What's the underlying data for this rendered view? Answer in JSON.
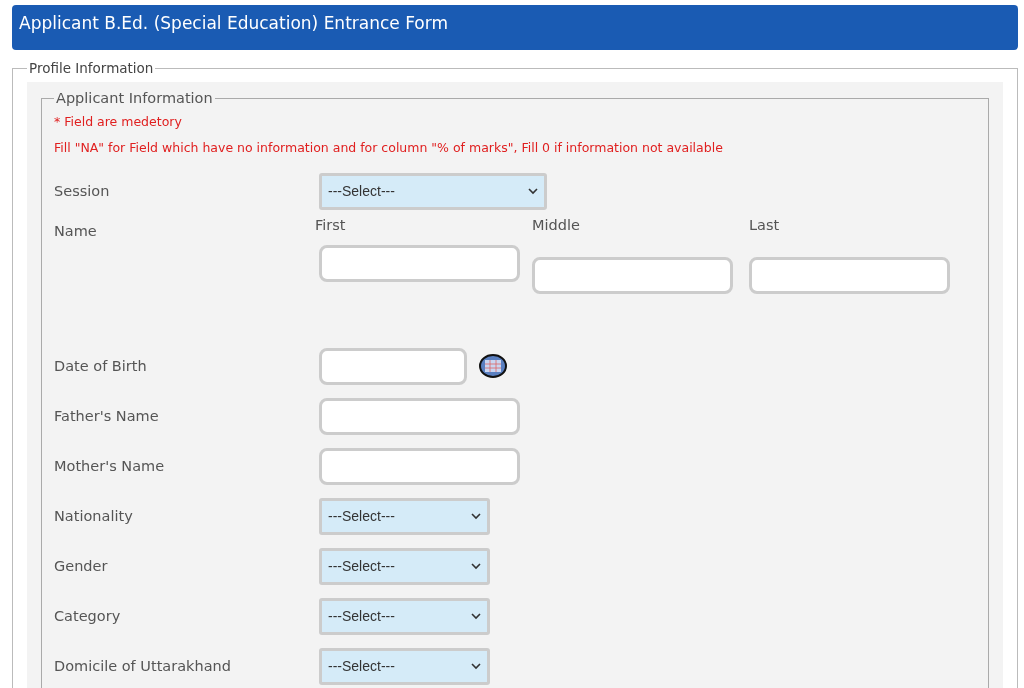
{
  "header": {
    "title": "Applicant B.Ed. (Special Education) Entrance Form"
  },
  "profile": {
    "legend": "Profile Information",
    "applicant": {
      "legend": "Applicant Information",
      "notes": [
        "* Field are medetory",
        "Fill \"NA\" for Field which have no information and for column \"% of marks\", Fill 0 if information not available"
      ],
      "fields": [
        {
          "kind": "select",
          "label": "Session",
          "value": "---Select---"
        },
        {
          "kind": "name",
          "label": "Name",
          "parts": [
            {
              "label": "First"
            },
            {
              "label": "Middle"
            },
            {
              "label": "Last"
            }
          ]
        },
        {
          "kind": "date",
          "label": "Date of Birth"
        },
        {
          "kind": "text",
          "label": "Father's Name"
        },
        {
          "kind": "text",
          "label": "Mother's Name"
        },
        {
          "kind": "select",
          "label": "Nationality",
          "value": "---Select---"
        },
        {
          "kind": "select",
          "label": "Gender",
          "value": "---Select---"
        },
        {
          "kind": "select",
          "label": "Category",
          "value": "---Select---"
        },
        {
          "kind": "select",
          "label": "Domicile of Uttarakhand",
          "value": "---Select---"
        }
      ]
    }
  }
}
